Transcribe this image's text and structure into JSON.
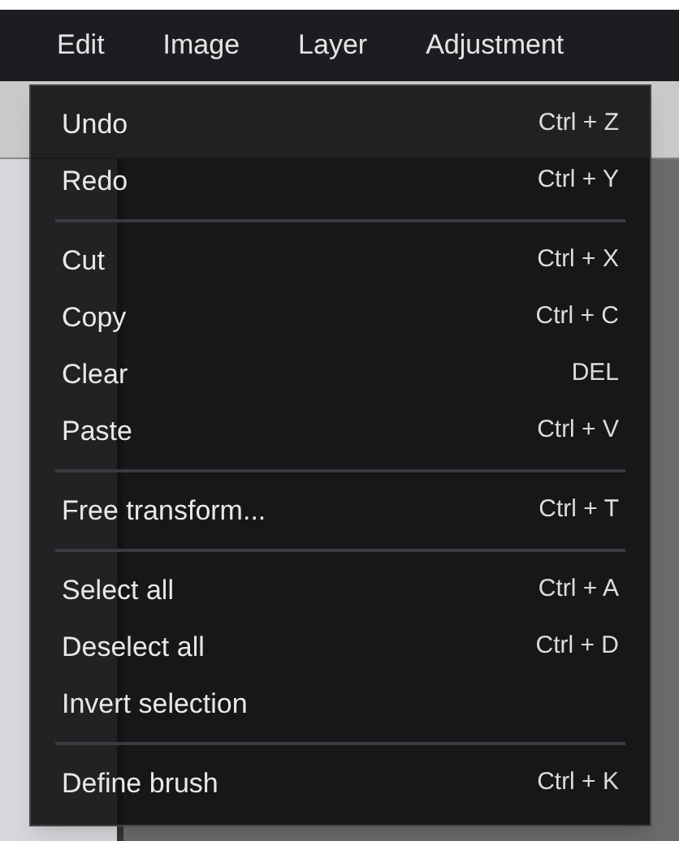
{
  "menu_bar": {
    "items": [
      "Edit",
      "Image",
      "Layer",
      "Adjustment"
    ]
  },
  "edit_menu": {
    "groups": [
      [
        {
          "label": "Undo",
          "shortcut": "Ctrl + Z"
        },
        {
          "label": "Redo",
          "shortcut": "Ctrl + Y"
        }
      ],
      [
        {
          "label": "Cut",
          "shortcut": "Ctrl + X"
        },
        {
          "label": "Copy",
          "shortcut": "Ctrl + C"
        },
        {
          "label": "Clear",
          "shortcut": "DEL"
        },
        {
          "label": "Paste",
          "shortcut": "Ctrl + V"
        }
      ],
      [
        {
          "label": "Free transform...",
          "shortcut": "Ctrl + T"
        }
      ],
      [
        {
          "label": "Select all",
          "shortcut": "Ctrl + A"
        },
        {
          "label": "Deselect all",
          "shortcut": "Ctrl + D"
        },
        {
          "label": "Invert selection"
        }
      ],
      [
        {
          "label": "Define brush",
          "shortcut": "Ctrl + K"
        }
      ]
    ]
  }
}
